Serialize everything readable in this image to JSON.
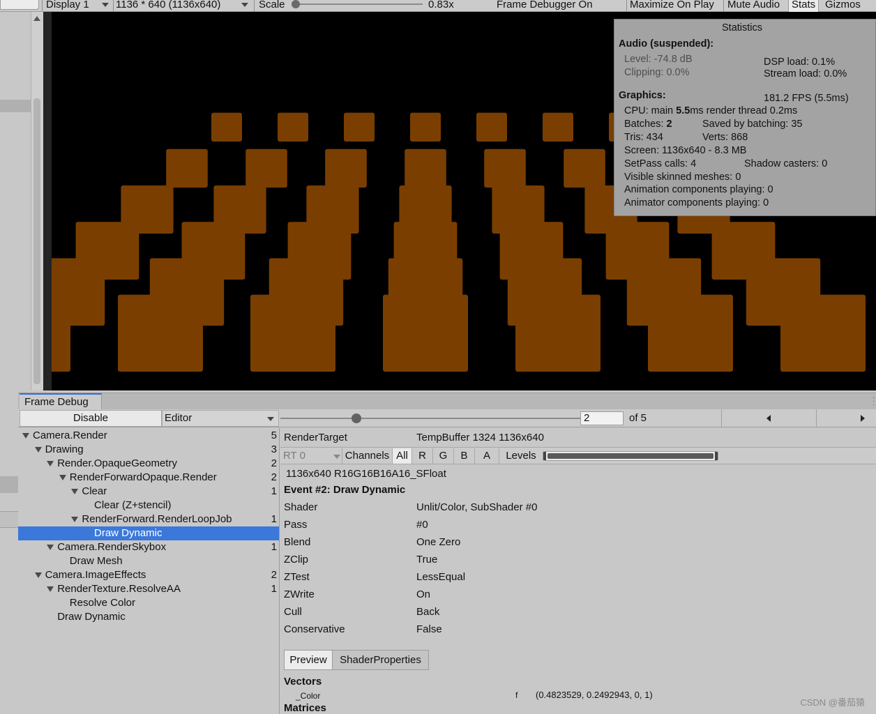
{
  "toolbar": {
    "display": "Display 1",
    "resolution": "1136 * 640 (1136x640)",
    "scale_label": "Scale",
    "scale_value": "0.83x",
    "frame_debugger_status": "Frame Debugger On",
    "maximize": "Maximize On Play",
    "mute": "Mute Audio",
    "stats": "Stats",
    "gizmos": "Gizmos"
  },
  "stats": {
    "title": "Statistics",
    "audio_header": "Audio (suspended):",
    "level": "Level: -74.8 dB",
    "clipping": "Clipping: 0.0%",
    "dsp": "DSP load: 0.1%",
    "stream": "Stream load: 0.0%",
    "graphics_header": "Graphics:",
    "fps": "181.2 FPS (5.5ms)",
    "cpu_prefix": "CPU: main ",
    "cpu_main": "5.5",
    "cpu_suffix": "ms  render thread 0.2ms",
    "batches_prefix": "Batches: ",
    "batches_value": "2",
    "saved": "Saved by batching: 35",
    "tris": "Tris: 434",
    "verts": "Verts: 868",
    "screen": "Screen: 1136x640 - 8.3 MB",
    "setpass": "SetPass calls: 4",
    "shadow": "Shadow casters: 0",
    "skinned": "Visible skinned meshes: 0",
    "animation": "Animation components playing: 0",
    "animator": "Animator components playing: 0"
  },
  "frame_debug": {
    "tab": "Frame Debug",
    "disable": "Disable",
    "target": "Editor",
    "event_current": "2",
    "event_of": "of 5"
  },
  "tree": [
    {
      "label": "Camera.Render",
      "count": "5"
    },
    {
      "label": "Drawing",
      "count": "3"
    },
    {
      "label": "Render.OpaqueGeometry",
      "count": "2"
    },
    {
      "label": "RenderForwardOpaque.Render",
      "count": "2"
    },
    {
      "label": "Clear",
      "count": "1"
    },
    {
      "label": "Clear (Z+stencil)",
      "count": ""
    },
    {
      "label": "RenderForward.RenderLoopJob",
      "count": "1"
    },
    {
      "label": "Draw Dynamic",
      "count": ""
    },
    {
      "label": "Camera.RenderSkybox",
      "count": "1"
    },
    {
      "label": "Draw Mesh",
      "count": ""
    },
    {
      "label": "Camera.ImageEffects",
      "count": "2"
    },
    {
      "label": "RenderTexture.ResolveAA",
      "count": "1"
    },
    {
      "label": "Resolve Color",
      "count": ""
    },
    {
      "label": "Draw Dynamic",
      "count": ""
    }
  ],
  "details": {
    "render_target_label": "RenderTarget",
    "render_target_value": "TempBuffer 1324 1136x640",
    "rt": "RT 0",
    "channels_label": "Channels",
    "channels": [
      "All",
      "R",
      "G",
      "B",
      "A"
    ],
    "levels_label": "Levels",
    "format": "1136x640 R16G16B16A16_SFloat",
    "event_title": "Event #2: Draw Dynamic",
    "props": [
      {
        "label": "Shader",
        "value": "Unlit/Color, SubShader #0"
      },
      {
        "label": "Pass",
        "value": "#0"
      },
      {
        "label": "Blend",
        "value": "One Zero"
      },
      {
        "label": "ZClip",
        "value": "True"
      },
      {
        "label": "ZTest",
        "value": "LessEqual"
      },
      {
        "label": "ZWrite",
        "value": "On"
      },
      {
        "label": "Cull",
        "value": "Back"
      },
      {
        "label": "Conservative",
        "value": "False"
      }
    ],
    "tab_preview": "Preview",
    "tab_shader": "ShaderProperties",
    "vectors_header": "Vectors",
    "vector_name": "_Color",
    "vector_type": "f",
    "vector_value": "(0.4823529, 0.2492943, 0, 1)",
    "matrices_header": "Matrices"
  },
  "watermark": "CSDN @番茄猿",
  "colors": {
    "cube": "#7a3f00",
    "selection": "#3b78d9",
    "accent": "#3a72d1"
  }
}
